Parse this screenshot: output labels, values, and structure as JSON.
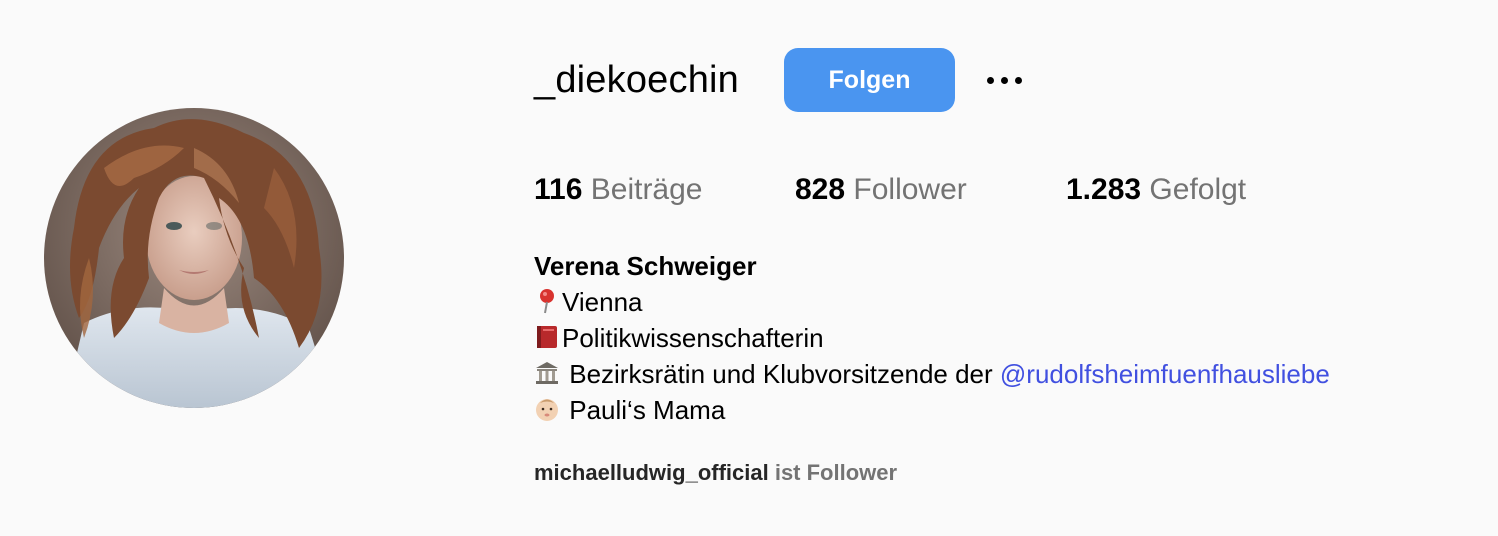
{
  "profile": {
    "username": "_diekoechin",
    "follow_label": "Folgen",
    "stats": [
      {
        "num": "116",
        "label": "Beiträge"
      },
      {
        "num": "828",
        "label": "Follower"
      },
      {
        "num": "1.283",
        "label": "Gefolgt"
      }
    ],
    "full_name": "Verena Schweiger",
    "bio": [
      {
        "icon": "pin-icon",
        "text": "Vienna"
      },
      {
        "icon": "book-icon",
        "text": "Politikwissenschafterin"
      },
      {
        "icon": "classical-building-icon",
        "text": " Bezirksrätin und Klubvorsitzende der ",
        "mention": "@rudolfsheimfuenfhausliebe"
      },
      {
        "icon": "baby-icon",
        "text": " Pauli‘s Mama"
      }
    ],
    "followed_by_user": "michaelludwig_official",
    "followed_by_suffix": " ist Follower"
  },
  "colors": {
    "button": "#4a95f0",
    "link": "#4150e0",
    "muted": "#737373",
    "background": "#fafafa"
  }
}
